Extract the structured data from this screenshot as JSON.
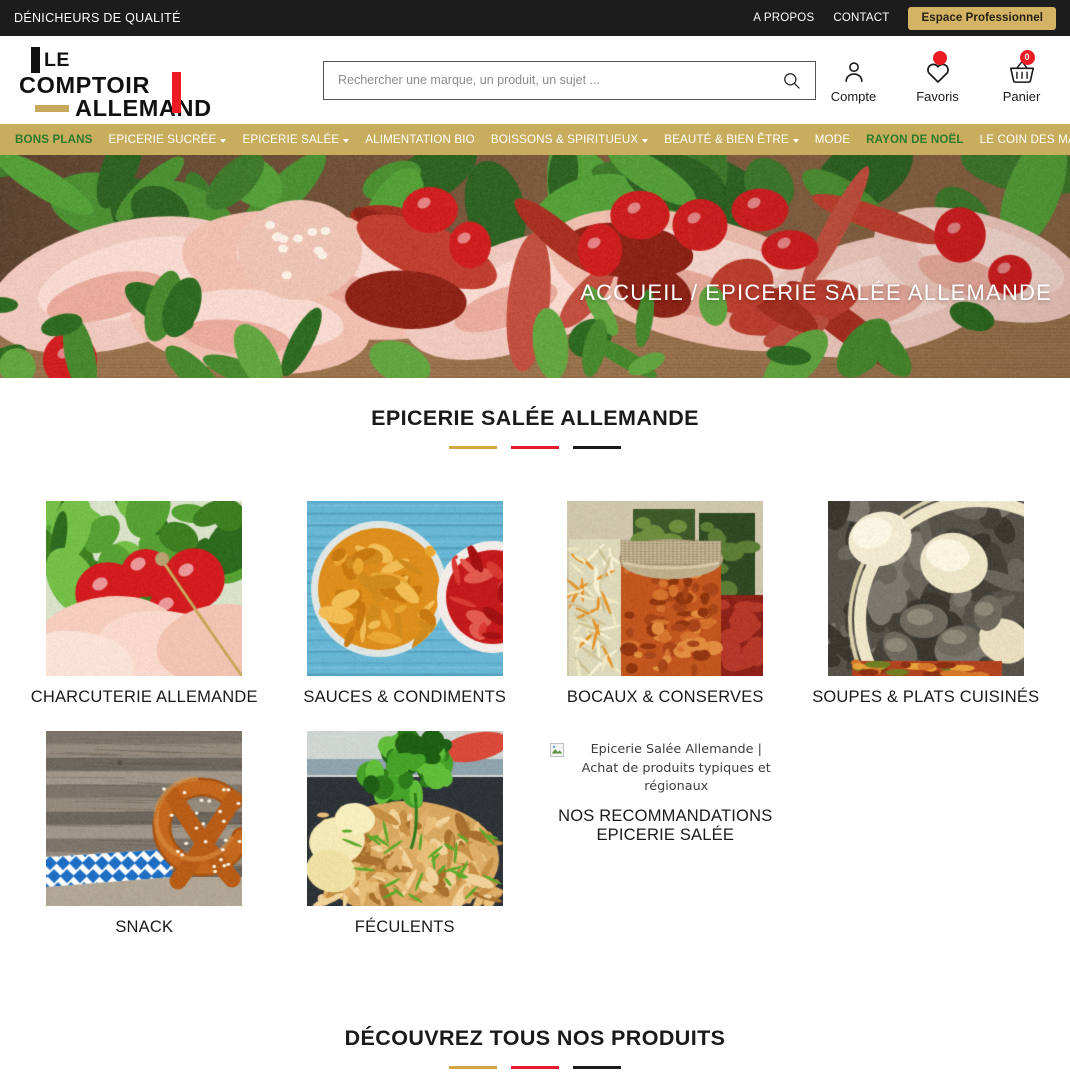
{
  "topbar": {
    "tagline": "DÉNICHEURS DE QUALITÉ",
    "links": [
      {
        "label": "A PROPOS",
        "name": "topbar-link-a-propos"
      },
      {
        "label": "CONTACT",
        "name": "topbar-link-contact"
      }
    ],
    "pro_button": "Espace Professionnel"
  },
  "logo": {
    "line1": "LE",
    "line2": "COMPTOIR",
    "line3": "ALLEMAND",
    "bar_black_color": "#111111",
    "bar_red_color": "#ed1c24",
    "dash_color": "#c8a75c"
  },
  "search": {
    "placeholder": "Rechercher une marque, un produit, un sujet ...",
    "value": ""
  },
  "header_icons": [
    {
      "label": "Compte",
      "icon": "user-icon",
      "badge": null
    },
    {
      "label": "Favoris",
      "icon": "heart-icon",
      "badge": ""
    },
    {
      "label": "Panier",
      "icon": "basket-icon",
      "badge": "0"
    }
  ],
  "nav": {
    "background": "#c8ad5e",
    "items": [
      {
        "label": "BONS PLANS",
        "highlight": true,
        "caret": false
      },
      {
        "label": "EPICERIE SUCRÉE",
        "highlight": false,
        "caret": true
      },
      {
        "label": "EPICERIE SALÉE",
        "highlight": false,
        "caret": true
      },
      {
        "label": "ALIMENTATION BIO",
        "highlight": false,
        "caret": false
      },
      {
        "label": "BOISSONS & SPIRITUEUX",
        "highlight": false,
        "caret": true
      },
      {
        "label": "BEAUTÉ & BIEN ÊTRE",
        "highlight": false,
        "caret": true
      },
      {
        "label": "MODE",
        "highlight": false,
        "caret": false
      },
      {
        "label": "RAYON DE NOËL",
        "highlight": true,
        "caret": false
      },
      {
        "label": "LE COIN DES MARQUES",
        "highlight": false,
        "caret": false
      }
    ]
  },
  "hero": {
    "breadcrumb_home": "ACCUEIL",
    "breadcrumb_sep": "/",
    "breadcrumb_current": "EPICERIE SALÉE ALLEMANDE"
  },
  "main": {
    "title": "EPICERIE SALÉE ALLEMANDE",
    "bottom_title": "DÉCOUVREZ TOUS NOS PRODUITS"
  },
  "categories": [
    {
      "label": "CHARCUTERIE ALLEMANDE",
      "image": "charcuterie"
    },
    {
      "label": "SAUCES & CONDIMENTS",
      "image": "sauces"
    },
    {
      "label": "BOCAUX & CONSERVES",
      "image": "bocaux"
    },
    {
      "label": "SOUPES & PLATS CUISINÉS",
      "image": "soupes"
    },
    {
      "label": "SNACK",
      "image": "snack"
    },
    {
      "label": "FÉCULENTS",
      "image": "feculents"
    }
  ],
  "broken_tile": {
    "alt_text": "Epicerie Salée Allemande | Achat de produits typiques et régionaux",
    "label": "NOS RECOMMANDATIONS EPICERIE SALÉE"
  },
  "colors": {
    "topbar_bg": "#1c1c1c",
    "nav_bg": "#c8ad5e",
    "accent_gold": "#d4b464",
    "accent_red": "#ec1c24",
    "accent_green": "#2c7a2c",
    "flag_gold": "#d3a843",
    "flag_red": "#e8192c",
    "flag_black": "#1a1a1a"
  }
}
